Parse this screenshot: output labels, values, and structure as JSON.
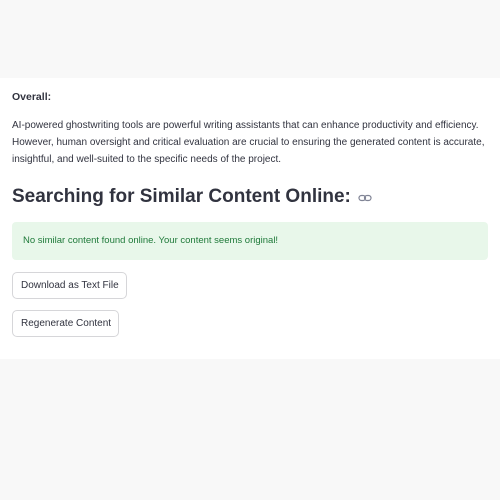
{
  "overall": {
    "label": "Overall:",
    "paragraph": "AI-powered ghostwriting tools are powerful writing assistants that can enhance productivity and efficiency. However, human oversight and critical evaluation are crucial to ensuring the generated content is accurate, insightful, and well-suited to the specific needs of the project."
  },
  "search_section": {
    "heading": "Searching for Similar Content Online:",
    "anchor_icon": "link-icon",
    "result_message": "No similar content found online. Your content seems original!",
    "result_color": "#1f7a3a",
    "result_bg": "#e8f7ea"
  },
  "actions": {
    "download_label": "Download as Text File",
    "regenerate_label": "Regenerate Content"
  }
}
